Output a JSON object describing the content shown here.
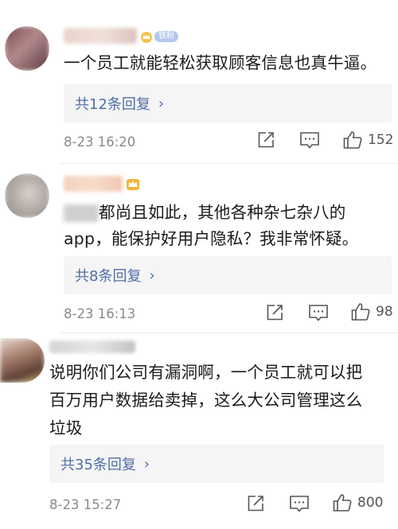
{
  "comments": [
    {
      "text": "一个员工就能轻松获取顾客信息也真牛逼。",
      "badge": "铁粉",
      "replies": "共12条回复",
      "time": "8-23 16:20",
      "likes": "152"
    },
    {
      "text_line1": "都尚且如此，其他各种杂七杂八的",
      "text_line2": "app，能保护好用户隐私？我非常怀疑。",
      "replies": "共8条回复",
      "time": "8-23 16:13",
      "likes": "98"
    },
    {
      "text_line1": "说明你们公司有漏洞啊，一个员工就可以把",
      "text_line2": "百万用户数据给卖掉，这么大公司管理这么",
      "text_line3": "垃圾",
      "replies": "共35条回复",
      "time": "8-23 15:27",
      "likes": "800"
    }
  ],
  "icons": {
    "share": "share-icon",
    "comment": "comment-icon",
    "like": "like-icon",
    "crown": "crown-icon",
    "chevron": "chevron-right-icon"
  },
  "colors": {
    "link": "#4f6ea8",
    "reply_bg": "#f5f5f5",
    "time": "#8a8a8a",
    "badge": "#b5c7ef"
  }
}
